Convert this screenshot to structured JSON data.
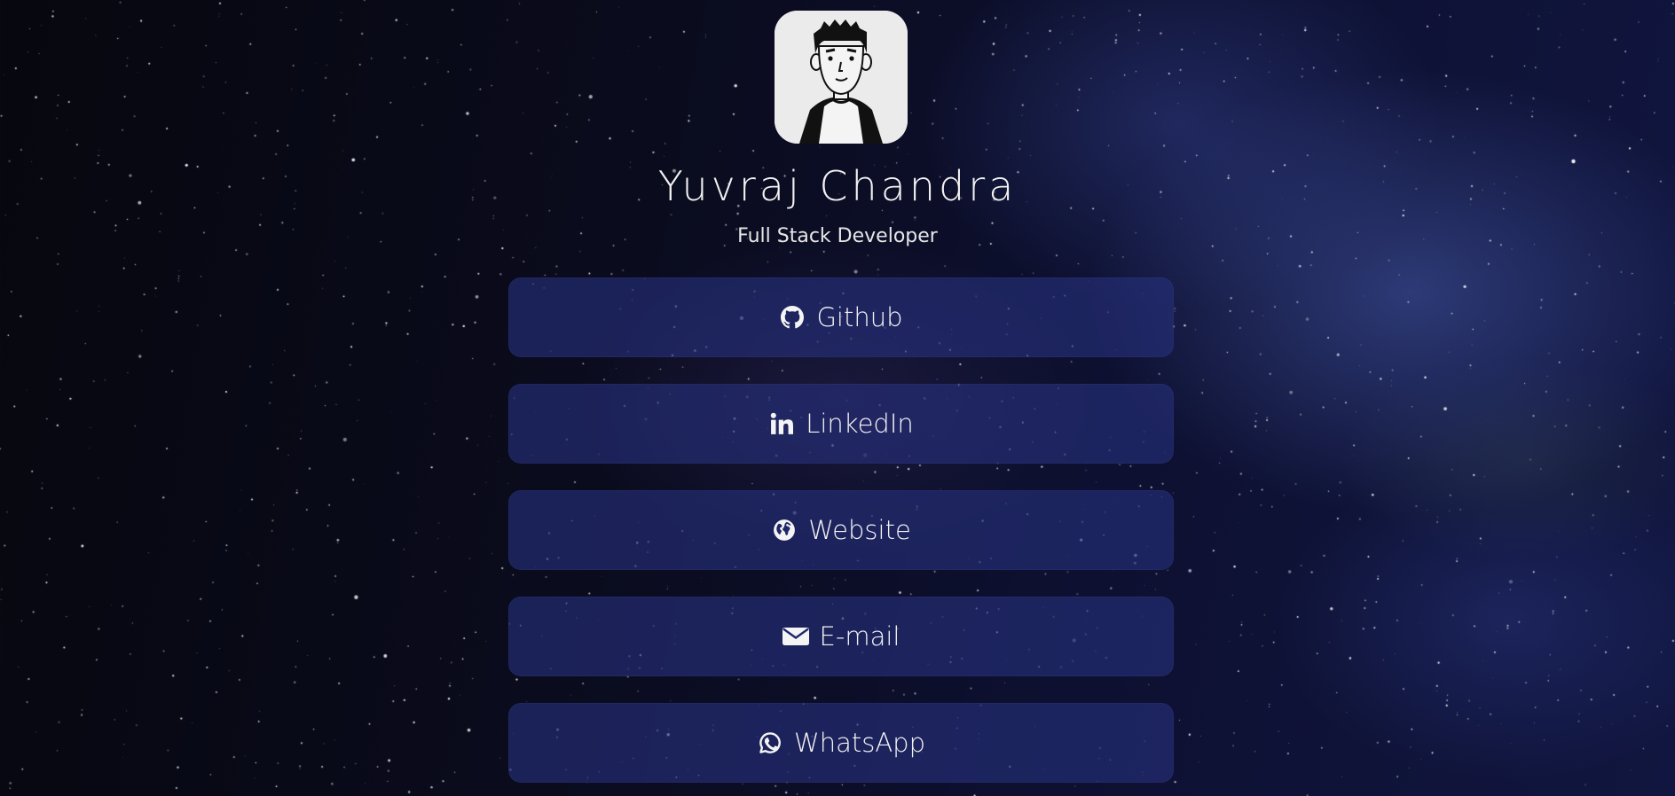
{
  "profile": {
    "name": "Yuvraj Chandra",
    "role": "Full Stack Developer",
    "avatar_icon": "cartoon-avatar-icon"
  },
  "links": [
    {
      "label": "Github",
      "icon": "github-icon"
    },
    {
      "label": "LinkedIn",
      "icon": "linkedin-icon"
    },
    {
      "label": "Website",
      "icon": "globe-icon"
    },
    {
      "label": "E-mail",
      "icon": "envelope-icon"
    },
    {
      "label": "WhatsApp",
      "icon": "whatsapp-icon"
    }
  ],
  "colors": {
    "button_bg": "#262f7d",
    "text": "#f4f4f4",
    "background": "#0a0b1c"
  }
}
